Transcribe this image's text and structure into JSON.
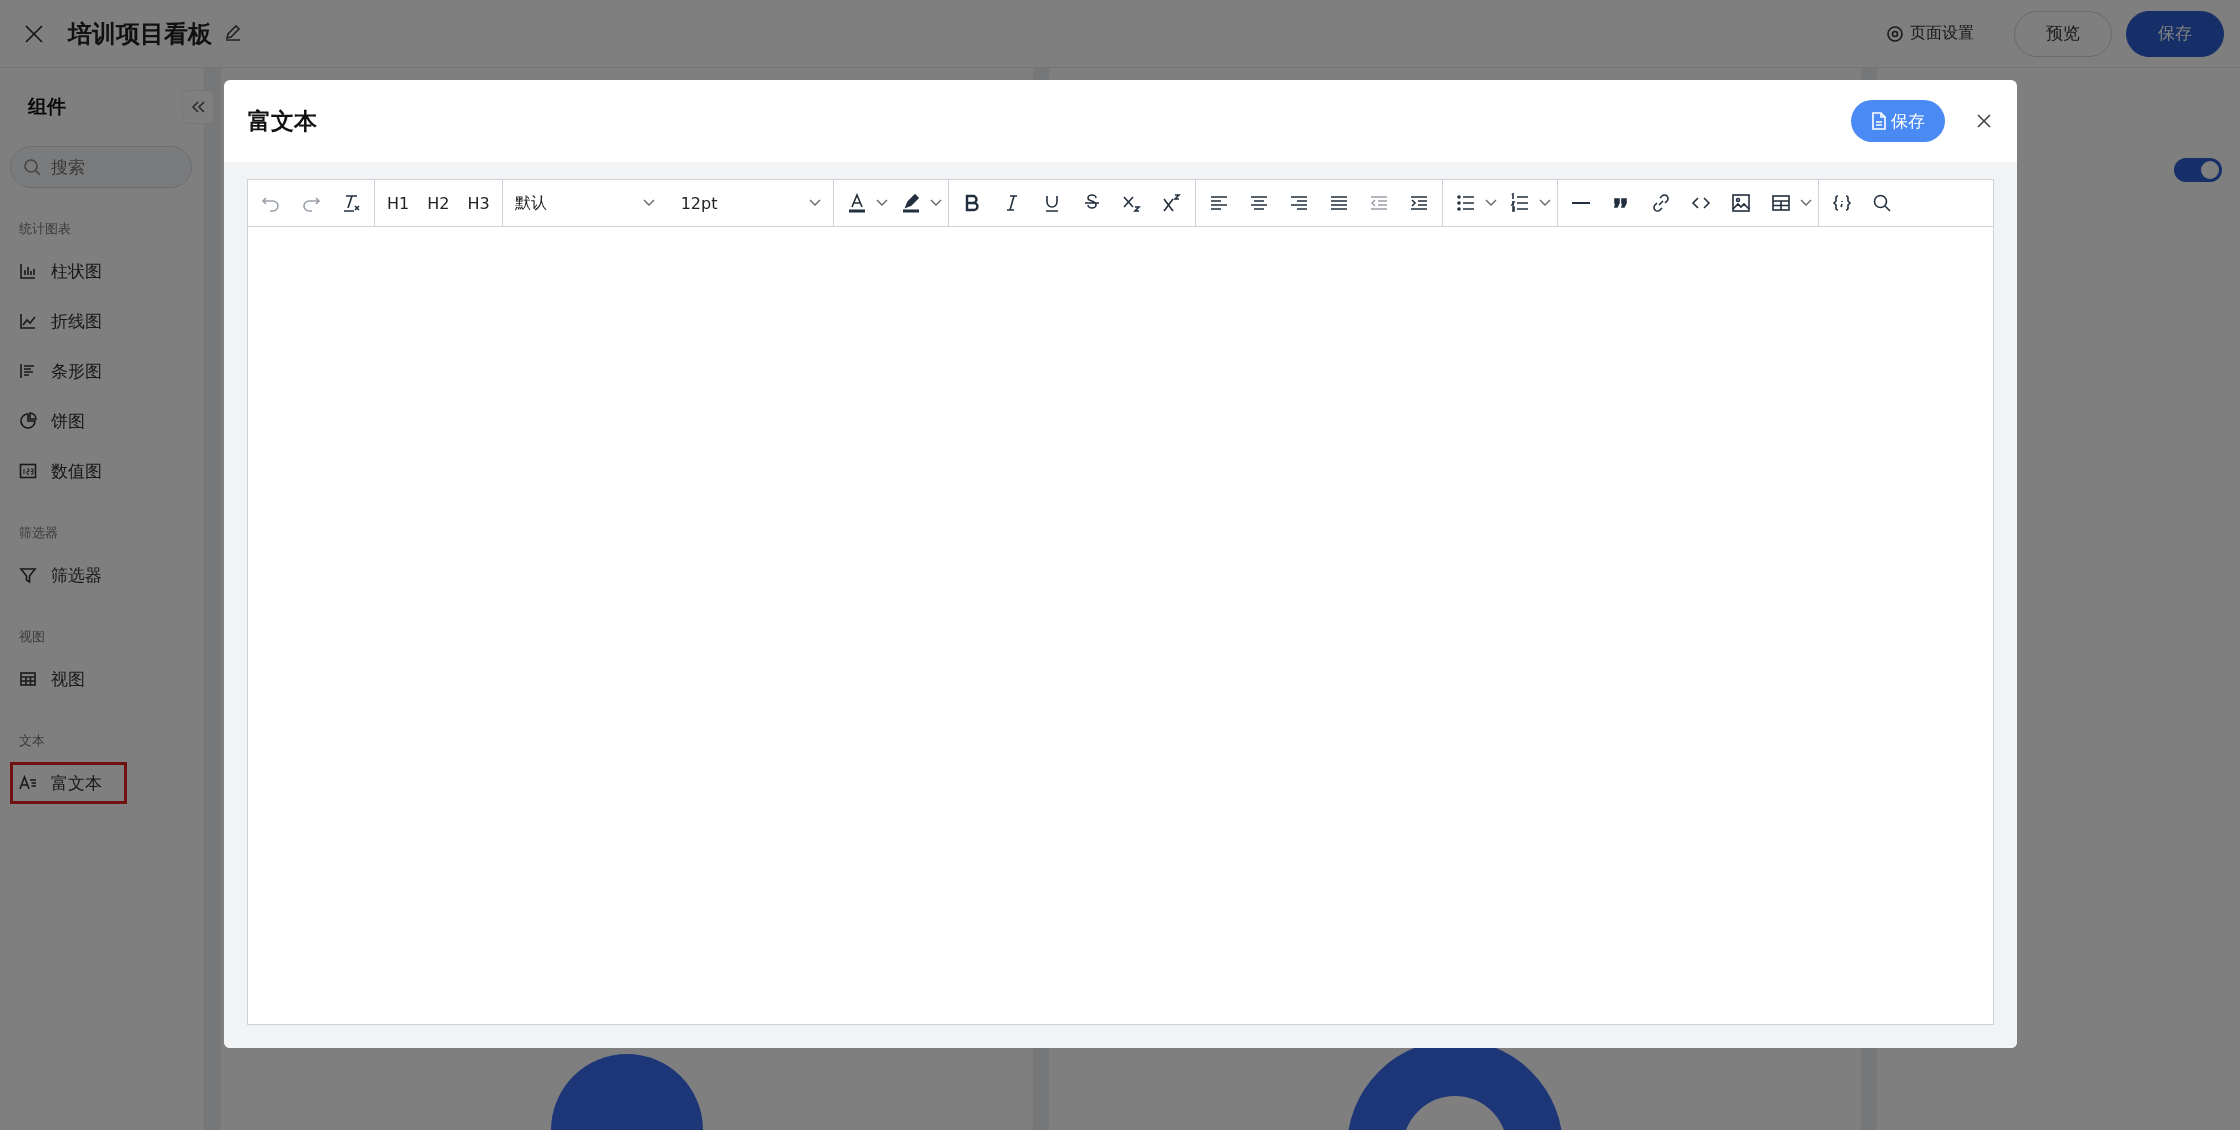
{
  "topbar": {
    "title": "培训项目看板",
    "page_settings": "页面设置",
    "preview_button": "预览",
    "save_button": "保存"
  },
  "sidebar": {
    "title": "组件",
    "search": {
      "placeholder": "搜索"
    },
    "groups": [
      {
        "label": "统计图表",
        "items": [
          {
            "label": "柱状图",
            "kind": "bar",
            "selected": false
          },
          {
            "label": "折线图",
            "kind": "line",
            "selected": false
          },
          {
            "label": "条形图",
            "kind": "hbar",
            "selected": false
          },
          {
            "label": "饼图",
            "kind": "pie",
            "selected": false
          },
          {
            "label": "数值图",
            "kind": "number",
            "selected": false
          }
        ]
      },
      {
        "label": "筛选器",
        "items": [
          {
            "label": "筛选器",
            "kind": "filter",
            "selected": false
          }
        ]
      },
      {
        "label": "视图",
        "items": [
          {
            "label": "视图",
            "kind": "table",
            "selected": false
          }
        ]
      },
      {
        "label": "文本",
        "items": [
          {
            "label": "富文本",
            "kind": "text",
            "selected": true
          }
        ]
      }
    ]
  },
  "right_panel": {
    "toggle": {
      "on": true
    }
  },
  "modal": {
    "title": "富文本",
    "save_button": "保存",
    "toolbar": {
      "headings": [
        "H1",
        "H2",
        "H3"
      ],
      "font_family": "默认",
      "font_size": "12pt"
    }
  }
}
